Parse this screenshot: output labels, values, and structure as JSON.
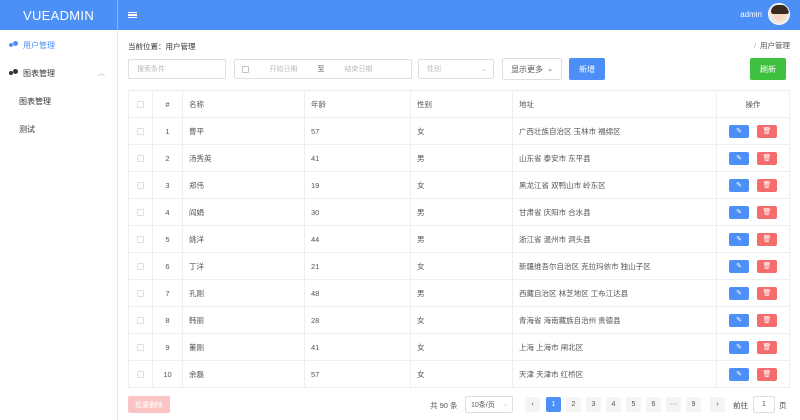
{
  "brand": "VUEADMIN",
  "user": {
    "name": "admin"
  },
  "sidebar": {
    "items": [
      {
        "label": "用户管理"
      },
      {
        "label": "图表管理"
      },
      {
        "label": "图表管理"
      },
      {
        "label": "测试"
      }
    ]
  },
  "breadcrumb": {
    "prefix": "当前位置：",
    "current": "用户管理",
    "right": "用户管理"
  },
  "filters": {
    "search_placeholder": "搜索条件",
    "start_placeholder": "开始日期",
    "range_sep": "至",
    "end_placeholder": "结束日期",
    "gender_placeholder": "性别",
    "more_label": "显示更多",
    "add_label": "新增",
    "refresh_label": "刷新"
  },
  "table": {
    "headers": [
      "#",
      "名称",
      "年龄",
      "性别",
      "地址",
      "操作"
    ],
    "rows": [
      {
        "idx": "1",
        "name": "曹平",
        "age": "57",
        "gender": "女",
        "address": "广西壮族自治区 玉林市 福绵区"
      },
      {
        "idx": "2",
        "name": "汤秀英",
        "age": "41",
        "gender": "男",
        "address": "山东省 泰安市 东平县"
      },
      {
        "idx": "3",
        "name": "郑伟",
        "age": "19",
        "gender": "女",
        "address": "黑龙江省 双鸭山市 岭东区"
      },
      {
        "idx": "4",
        "name": "阎娟",
        "age": "30",
        "gender": "男",
        "address": "甘肃省 庆阳市 合水县"
      },
      {
        "idx": "5",
        "name": "姚洋",
        "age": "44",
        "gender": "男",
        "address": "浙江省 温州市 洞头县"
      },
      {
        "idx": "6",
        "name": "丁洋",
        "age": "21",
        "gender": "女",
        "address": "新疆维吾尔自治区 克拉玛依市 独山子区"
      },
      {
        "idx": "7",
        "name": "孔刚",
        "age": "48",
        "gender": "男",
        "address": "西藏自治区 林芝地区 工布江达县"
      },
      {
        "idx": "8",
        "name": "韩丽",
        "age": "28",
        "gender": "女",
        "address": "青海省 海南藏族自治州 贵德县"
      },
      {
        "idx": "9",
        "name": "董刚",
        "age": "41",
        "gender": "女",
        "address": "上海 上海市 闸北区"
      },
      {
        "idx": "10",
        "name": "余磊",
        "age": "57",
        "gender": "女",
        "address": "天津 天津市 红桥区"
      }
    ]
  },
  "footer": {
    "batch_delete": "批量删除",
    "total": "共 90 条",
    "page_size": "10条/页",
    "pages": [
      "1",
      "2",
      "3",
      "4",
      "5",
      "6",
      "···",
      "9"
    ],
    "current_page": "1",
    "goto_label": "前往",
    "goto_value": "1",
    "page_suffix": "页"
  },
  "icons": {
    "menu": "hamburger-icon",
    "users": "users-icon",
    "chart": "chart-icon",
    "calendar": "calendar-icon",
    "edit": "edit-icon",
    "delete": "trash-icon",
    "prev": "chevron-left-icon",
    "next": "chevron-right-icon"
  },
  "colors": {
    "primary": "#4c8ff7",
    "success": "#3fc13f",
    "danger": "#f56c6c"
  }
}
